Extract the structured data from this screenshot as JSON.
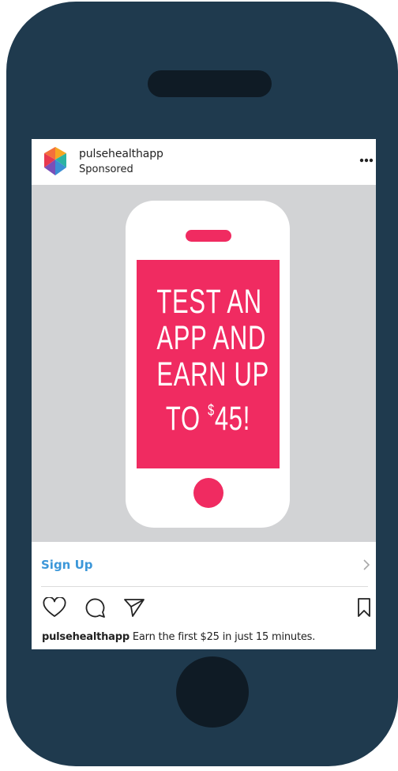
{
  "post": {
    "account_name": "pulsehealthapp",
    "sponsored_label": "Sponsored",
    "avatar_icon": "pulsehealthapp-logo",
    "more_icon": "more-options-icon"
  },
  "ad": {
    "promo_lines": [
      "TEST AN",
      "APP AND",
      "EARN UP",
      "TO",
      "$",
      "45!"
    ],
    "colors": {
      "background": "#d2d3d5",
      "accent": "#f02b61",
      "phone": "#ffffff"
    }
  },
  "cta": {
    "label": "Sign Up",
    "icon": "chevron-right-icon",
    "color": "#3c97d9"
  },
  "actions": {
    "icons": [
      "heart-icon",
      "comment-icon",
      "share-icon",
      "bookmark-icon"
    ]
  },
  "caption": {
    "username": "pulsehealthapp",
    "text": "Earn the first $25 in just 15 minutes."
  },
  "device": {
    "frame_color": "#1f3a4e",
    "detail_color": "#0f1b25"
  }
}
